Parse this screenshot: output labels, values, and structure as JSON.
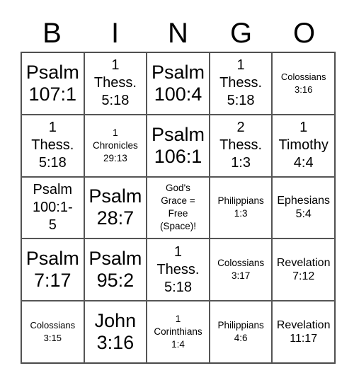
{
  "header": {
    "letters": [
      "B",
      "I",
      "N",
      "G",
      "O"
    ]
  },
  "card": {
    "rows": [
      [
        {
          "text": "Psalm\n107:1",
          "size": "xl"
        },
        {
          "text": "1\nThess.\n5:18",
          "size": "lg"
        },
        {
          "text": "Psalm\n100:4",
          "size": "xl"
        },
        {
          "text": "1\nThess.\n5:18",
          "size": "lg"
        },
        {
          "text": "Colossians\n3:16",
          "size": "xs"
        }
      ],
      [
        {
          "text": "1\nThess.\n5:18",
          "size": "lg"
        },
        {
          "text": "1\nChronicles\n29:13",
          "size": "sm"
        },
        {
          "text": "Psalm\n106:1",
          "size": "xl"
        },
        {
          "text": "2\nThess.\n1:3",
          "size": "lg"
        },
        {
          "text": "1\nTimothy\n4:4",
          "size": "lg"
        }
      ],
      [
        {
          "text": "Psalm\n100:1-\n5",
          "size": "lg"
        },
        {
          "text": "Psalm\n28:7",
          "size": "xl"
        },
        {
          "text": "God's\nGrace =\nFree\n(Space)!",
          "size": "sm"
        },
        {
          "text": "Philippians\n1:3",
          "size": "sm"
        },
        {
          "text": "Ephesians\n5:4",
          "size": "md"
        }
      ],
      [
        {
          "text": "Psalm\n7:17",
          "size": "xl"
        },
        {
          "text": "Psalm\n95:2",
          "size": "xl"
        },
        {
          "text": "1\nThess.\n5:18",
          "size": "lg"
        },
        {
          "text": "Colossians\n3:17",
          "size": "sm"
        },
        {
          "text": "Revelation\n7:12",
          "size": "md"
        }
      ],
      [
        {
          "text": "Colossians\n3:15",
          "size": "xs"
        },
        {
          "text": "John\n3:16",
          "size": "xl"
        },
        {
          "text": "1\nCorinthians\n1:4",
          "size": "sm"
        },
        {
          "text": "Philippians\n4:6",
          "size": "sm"
        },
        {
          "text": "Revelation\n11:17",
          "size": "md"
        }
      ]
    ]
  }
}
